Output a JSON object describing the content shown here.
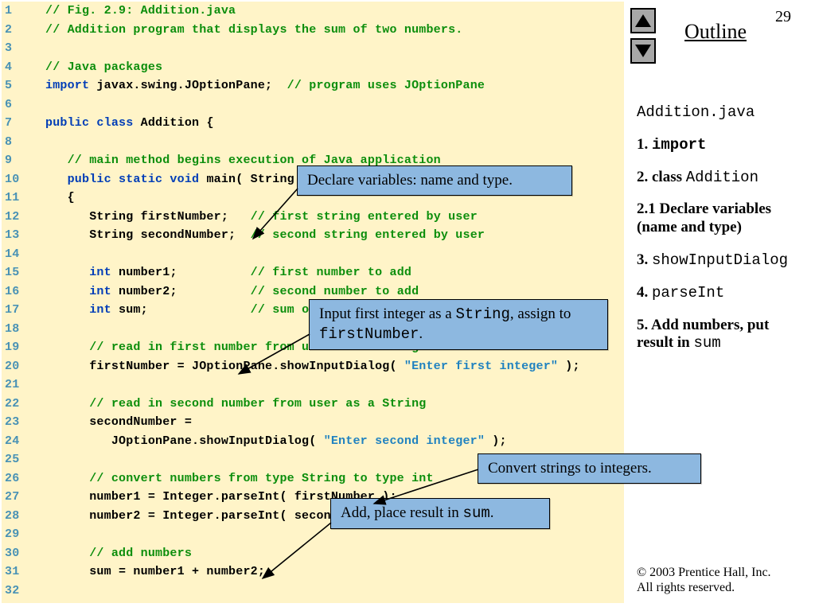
{
  "page_number": "29",
  "outline_title": "Outline",
  "outline": {
    "file": "Addition.java",
    "items": [
      {
        "num": "1.",
        "text": "import",
        "mono": true,
        "bold": true
      },
      {
        "num": "2.",
        "text": "class ",
        "mono": false,
        "bold": true,
        "tail": "Addition",
        "tail_mono": true
      },
      {
        "num": "2.1",
        "text": "Declare variables (name and type)",
        "mono": false,
        "bold": true
      },
      {
        "num": "3.",
        "text": "showInputDialog",
        "mono": true,
        "bold": false
      },
      {
        "num": "4.",
        "text": "parseInt",
        "mono": true,
        "bold": false
      },
      {
        "num": "5.",
        "text": "Add numbers, put result in ",
        "mono": false,
        "bold": true,
        "tail": "sum",
        "tail_mono": true
      }
    ]
  },
  "copyright": "© 2003 Prentice Hall, Inc.\nAll rights reserved.",
  "callouts": {
    "declare": "Declare variables: name and type.",
    "convert": "Convert strings to integers.",
    "input_pre": "Input first integer as a ",
    "input_code1": "String",
    "input_mid": ", assign to ",
    "input_code2": "firstNumber",
    "input_post": ".",
    "add_pre": "Add, place result in ",
    "add_code": "sum",
    "add_post": "."
  },
  "code_lines": [
    {
      "n": "1",
      "t": [
        [
          "cmt",
          "// Fig. 2.9: Addition.java"
        ]
      ]
    },
    {
      "n": "2",
      "t": [
        [
          "cmt",
          "// Addition program that displays the sum of two numbers."
        ]
      ]
    },
    {
      "n": "3",
      "t": []
    },
    {
      "n": "4",
      "t": [
        [
          "cmt",
          "// Java packages"
        ]
      ]
    },
    {
      "n": "5",
      "t": [
        [
          "kw",
          "import "
        ],
        [
          "id",
          "javax.swing.JOptionPane;  "
        ],
        [
          "cmt",
          "// program uses JOptionPane"
        ]
      ]
    },
    {
      "n": "6",
      "t": []
    },
    {
      "n": "7",
      "t": [
        [
          "kw",
          "public class "
        ],
        [
          "id",
          "Addition {"
        ]
      ]
    },
    {
      "n": "8",
      "t": []
    },
    {
      "n": "9",
      "t": [
        [
          "id",
          "   "
        ],
        [
          "cmt",
          "// main method begins execution of Java application"
        ]
      ]
    },
    {
      "n": "10",
      "t": [
        [
          "id",
          "   "
        ],
        [
          "kw",
          "public static void "
        ],
        [
          "id",
          "main( String args[] )"
        ]
      ]
    },
    {
      "n": "11",
      "t": [
        [
          "id",
          "   {"
        ]
      ]
    },
    {
      "n": "12",
      "t": [
        [
          "id",
          "      String firstNumber;   "
        ],
        [
          "cmt",
          "// first string entered by user"
        ]
      ]
    },
    {
      "n": "13",
      "t": [
        [
          "id",
          "      String secondNumber;  "
        ],
        [
          "cmt",
          "// second string entered by user"
        ]
      ]
    },
    {
      "n": "14",
      "t": []
    },
    {
      "n": "15",
      "t": [
        [
          "id",
          "      "
        ],
        [
          "kw",
          "int "
        ],
        [
          "id",
          "number1;          "
        ],
        [
          "cmt",
          "// first number to add"
        ]
      ]
    },
    {
      "n": "16",
      "t": [
        [
          "id",
          "      "
        ],
        [
          "kw",
          "int "
        ],
        [
          "id",
          "number2;          "
        ],
        [
          "cmt",
          "// second number to add"
        ]
      ]
    },
    {
      "n": "17",
      "t": [
        [
          "id",
          "      "
        ],
        [
          "kw",
          "int "
        ],
        [
          "id",
          "sum;              "
        ],
        [
          "cmt",
          "// sum of number1 and number2"
        ]
      ]
    },
    {
      "n": "18",
      "t": []
    },
    {
      "n": "19",
      "t": [
        [
          "id",
          "      "
        ],
        [
          "cmt",
          "// read in first number from user as a String"
        ]
      ]
    },
    {
      "n": "20",
      "t": [
        [
          "id",
          "      firstNumber = JOptionPane.showInputDialog( "
        ],
        [
          "str",
          "\"Enter first integer\""
        ],
        [
          "id",
          " );"
        ]
      ]
    },
    {
      "n": "21",
      "t": []
    },
    {
      "n": "22",
      "t": [
        [
          "id",
          "      "
        ],
        [
          "cmt",
          "// read in second number from user as a String"
        ]
      ]
    },
    {
      "n": "23",
      "t": [
        [
          "id",
          "      secondNumber ="
        ]
      ]
    },
    {
      "n": "24",
      "t": [
        [
          "id",
          "         JOptionPane.showInputDialog( "
        ],
        [
          "str",
          "\"Enter second integer\""
        ],
        [
          "id",
          " );"
        ]
      ]
    },
    {
      "n": "25",
      "t": []
    },
    {
      "n": "26",
      "t": [
        [
          "id",
          "      "
        ],
        [
          "cmt",
          "// convert numbers from type String to type int"
        ]
      ]
    },
    {
      "n": "27",
      "t": [
        [
          "id",
          "      number1 = Integer.parseInt( firstNumber );"
        ]
      ]
    },
    {
      "n": "28",
      "t": [
        [
          "id",
          "      number2 = Integer.parseInt( secondNumber );"
        ]
      ]
    },
    {
      "n": "29",
      "t": []
    },
    {
      "n": "30",
      "t": [
        [
          "id",
          "      "
        ],
        [
          "cmt",
          "// add numbers"
        ]
      ]
    },
    {
      "n": "31",
      "t": [
        [
          "id",
          "      sum = number1 + number2;"
        ]
      ]
    },
    {
      "n": "32",
      "t": []
    }
  ]
}
